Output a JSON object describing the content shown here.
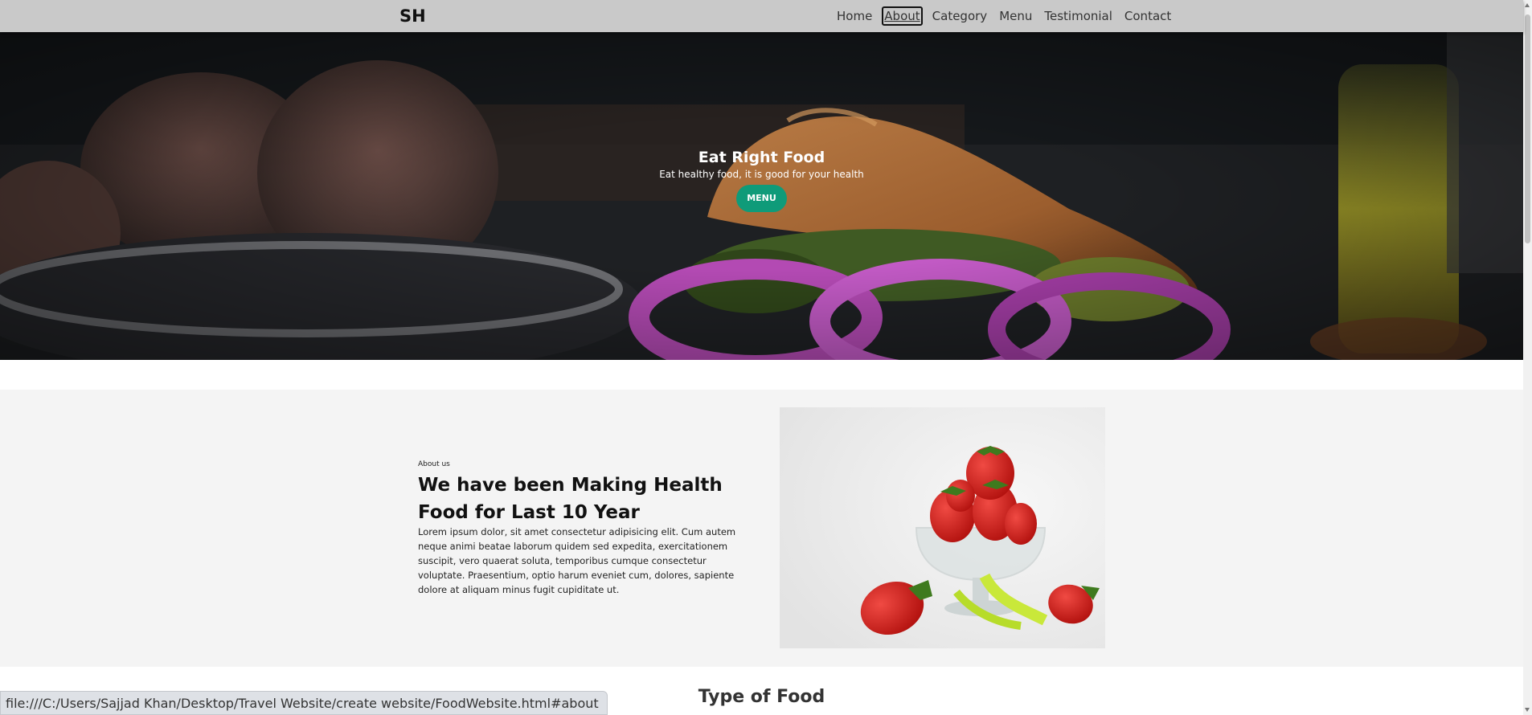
{
  "navbar": {
    "logo": "SH",
    "links": [
      "Home",
      "About",
      "Category",
      "Menu",
      "Testimonial",
      "Contact"
    ],
    "active": "About"
  },
  "hero": {
    "title": "Eat Right Food",
    "subtitle": "Eat healthy food, it is good for your health",
    "button_label": "MENU",
    "button_color": "#0f9b79"
  },
  "about": {
    "eyebrow": "About us",
    "heading": "We have been Making Health Food for Last 10 Year",
    "body": "Lorem ipsum dolor, sit amet consectetur adipisicing elit. Cum autem neque animi beatae laborum quidem sed expedita, exercitationem suscipit, vero quaerat soluta, temporibus cumque consectetur voluptate. Praesentium, optio harum eveniet cum, dolores, sapiente dolore at aliquam minus fugit cupiditate ut."
  },
  "section": {
    "type_title": "Type of Food"
  },
  "status_bar": {
    "url": "file:///C:/Users/Sajjad Khan/Desktop/Travel Website/create website/FoodWebsite.html#about"
  }
}
